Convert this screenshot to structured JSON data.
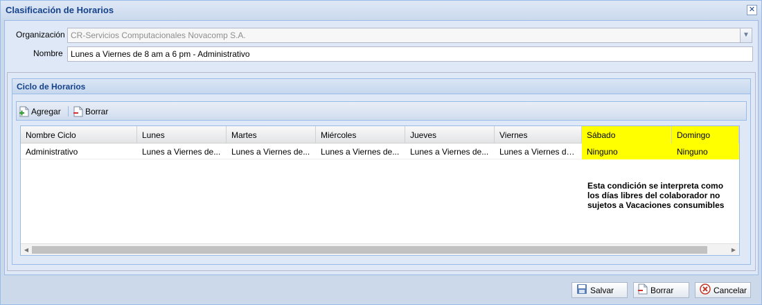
{
  "window": {
    "title": "Clasificación de Horarios"
  },
  "form": {
    "organizacion_label": "Organización",
    "organizacion_value": "CR-Servicios Computacionales Novacomp S.A.",
    "nombre_label": "Nombre",
    "nombre_value": "Lunes a Viernes de 8 am a 6 pm - Administrativo"
  },
  "ciclo": {
    "title": "Ciclo de Horarios",
    "toolbar": {
      "add_label": "Agregar",
      "delete_label": "Borrar"
    },
    "columns": [
      "Nombre Ciclo",
      "Lunes",
      "Martes",
      "Miércoles",
      "Jueves",
      "Viernes",
      "Sábado",
      "Domingo"
    ],
    "rows": [
      [
        "Administrativo",
        "Lunes a Viernes de...",
        "Lunes a Viernes de...",
        "Lunes a Viernes de...",
        "Lunes a Viernes de...",
        "Lunes a Viernes de...",
        "Ninguno",
        "Ninguno"
      ]
    ],
    "highlight_color": "#ffff00"
  },
  "note": {
    "line1": "Esta condición se interpreta como",
    "line2": "los días libres del colaborador no",
    "line3": "sujetos a Vacaciones consumibles"
  },
  "footer": {
    "save_label": "Salvar",
    "delete_label": "Borrar",
    "cancel_label": "Cancelar"
  }
}
